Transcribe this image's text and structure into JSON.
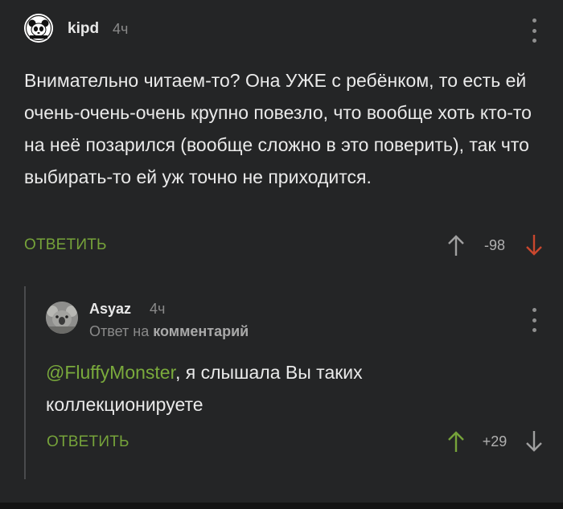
{
  "comment": {
    "username": "kipd",
    "time": "4ч",
    "text": "Внимательно читаем-то? Она УЖЕ с ребёнком, то есть ей очень-очень-очень крупно повезло, что вообще хоть кто-то на неё позарился (вообще сложно в это поверить), так что выбирать-то ей уж точно не приходится.",
    "reply_label": "ОТВЕТИТЬ",
    "score": "-98",
    "vote_state": "downvoted",
    "icons": [
      "avatar-panda",
      "more-vertical-icon",
      "arrow-up-icon",
      "arrow-down-icon"
    ]
  },
  "reply": {
    "username": "Asyaz",
    "time": "4ч",
    "reply_to_prefix": "Ответ на",
    "reply_to_link": "комментарий",
    "mention": "@FluffyMonster",
    "text": ", я слышала Вы таких коллекционируете",
    "reply_label": "ОТВЕТИТЬ",
    "score": "+29",
    "vote_state": "upvoted",
    "icons": [
      "avatar-koala",
      "more-vertical-icon",
      "arrow-up-icon",
      "arrow-down-icon"
    ]
  },
  "colors": {
    "background": "#242526",
    "accent_green": "#76a33a",
    "downvote_red": "#c9472e",
    "muted": "#8a8a8a"
  }
}
